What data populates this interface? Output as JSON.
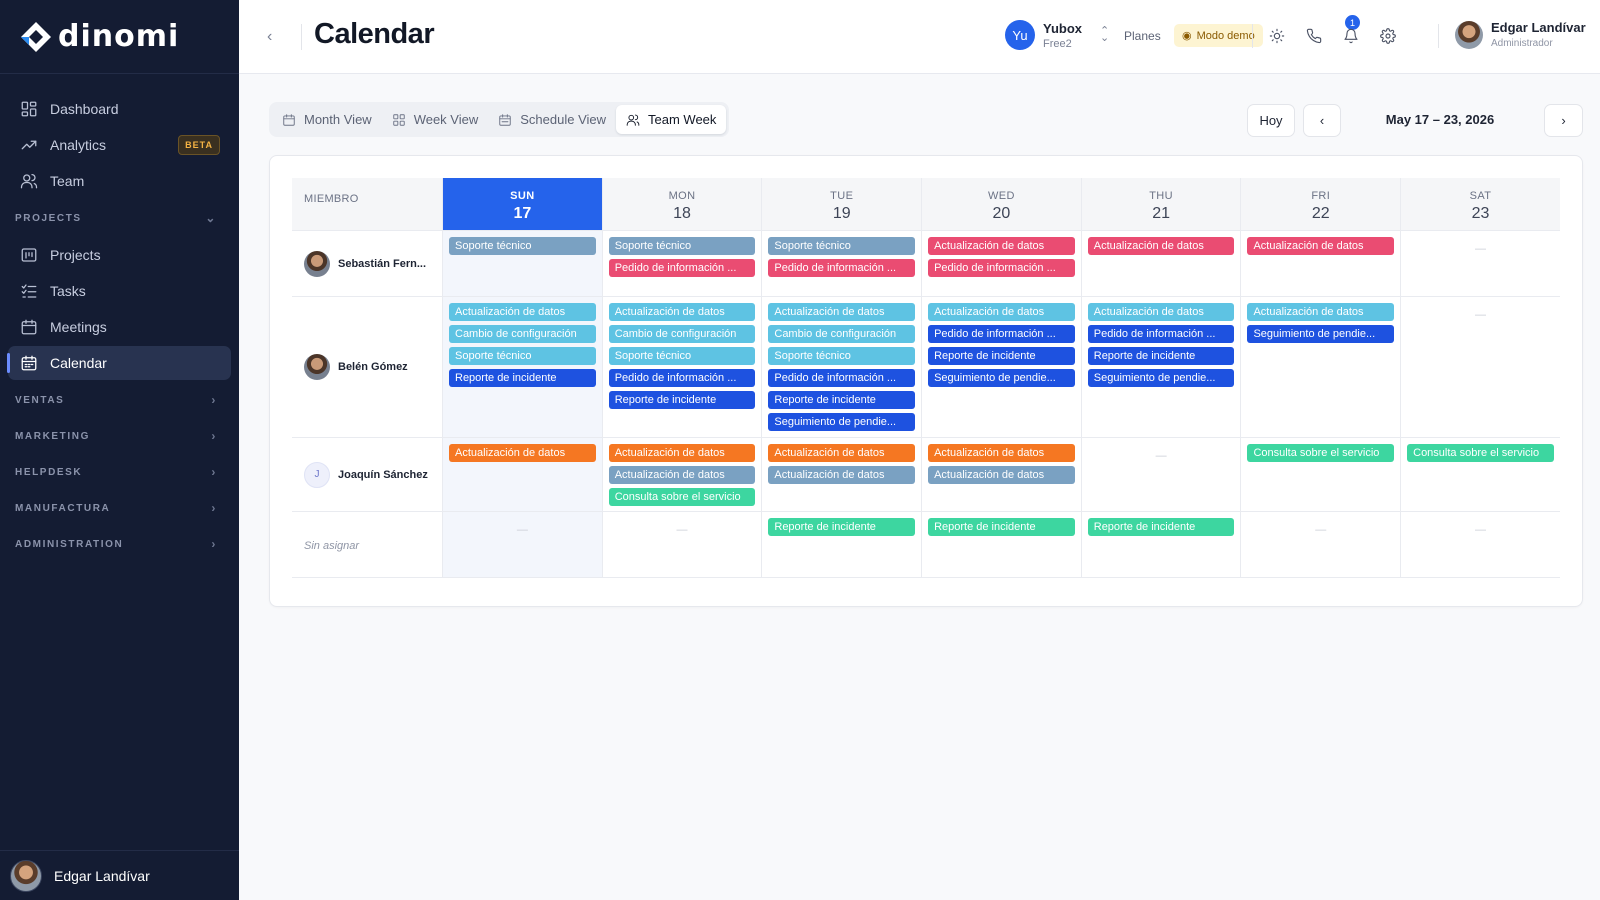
{
  "app": {
    "logo_text": "dinomi",
    "page_title": "Calendar",
    "back_icon": "chevron-left"
  },
  "sidebar": {
    "items": [
      {
        "label": "Dashboard",
        "icon": "dashboard-icon"
      },
      {
        "label": "Analytics",
        "icon": "analytics-icon",
        "badge": "BETA"
      },
      {
        "label": "Team",
        "icon": "team-icon"
      }
    ],
    "projects_section": "PROJECTS",
    "project_items": [
      {
        "label": "Projects",
        "icon": "projects-icon"
      },
      {
        "label": "Tasks",
        "icon": "tasks-icon"
      },
      {
        "label": "Meetings",
        "icon": "meetings-icon"
      },
      {
        "label": "Calendar",
        "icon": "calendar-icon",
        "active": true
      }
    ],
    "sections": [
      "VENTAS",
      "MARKETING",
      "HELPDESK",
      "MANUFACTURA",
      "ADMINISTRATION"
    ],
    "footer_user": "Edgar Landívar"
  },
  "header": {
    "org_initials": "Yu",
    "org_name": "Yubox",
    "org_plan": "Free2",
    "planes_label": "Planes",
    "demo_label": "Modo demo",
    "notification_count": "1",
    "user_name": "Edgar Landívar",
    "user_role": "Administrador",
    "icons": [
      "sun-icon",
      "phone-icon",
      "bell-icon",
      "gear-icon"
    ]
  },
  "toolbar": {
    "views": [
      {
        "label": "Month View",
        "icon": "calendar-icon"
      },
      {
        "label": "Week View",
        "icon": "grid-icon"
      },
      {
        "label": "Schedule View",
        "icon": "calendar-icon"
      },
      {
        "label": "Team Week",
        "icon": "users-icon",
        "active": true
      }
    ],
    "today_label": "Hoy",
    "date_range": "May 17 – 23, 2026"
  },
  "calendar": {
    "member_header": "MIEMBRO",
    "days": [
      {
        "name": "SUN",
        "num": "17",
        "today": true
      },
      {
        "name": "MON",
        "num": "18"
      },
      {
        "name": "TUE",
        "num": "19"
      },
      {
        "name": "WED",
        "num": "20"
      },
      {
        "name": "THU",
        "num": "21"
      },
      {
        "name": "FRI",
        "num": "22"
      },
      {
        "name": "SAT",
        "num": "23"
      }
    ],
    "empty_marker": "—",
    "event_colors": {
      "gray": "#7aa1c2",
      "red": "#ea4c72",
      "cyan": "#5ec3e3",
      "blue": "#1e52e0",
      "orange": "#f57722",
      "green": "#3dd6a0"
    },
    "rows": [
      {
        "member": "Sebastián Fern...",
        "avatar": "photo",
        "days": [
          [
            {
              "t": "Soporte técnico",
              "c": "gray"
            }
          ],
          [
            {
              "t": "Soporte técnico",
              "c": "gray"
            },
            {
              "t": "Pedido de información ...",
              "c": "red"
            }
          ],
          [
            {
              "t": "Soporte técnico",
              "c": "gray"
            },
            {
              "t": "Pedido de información ...",
              "c": "red"
            }
          ],
          [
            {
              "t": "Actualización de datos",
              "c": "red"
            },
            {
              "t": "Pedido de información ...",
              "c": "red"
            }
          ],
          [
            {
              "t": "Actualización de datos",
              "c": "red"
            }
          ],
          [
            {
              "t": "Actualización de datos",
              "c": "red"
            }
          ],
          []
        ]
      },
      {
        "member": "Belén Gómez",
        "avatar": "photo",
        "days": [
          [
            {
              "t": "Actualización de datos",
              "c": "cyan"
            },
            {
              "t": "Cambio de configuración",
              "c": "cyan"
            },
            {
              "t": "Soporte técnico",
              "c": "cyan"
            },
            {
              "t": "Reporte de incidente",
              "c": "blue"
            }
          ],
          [
            {
              "t": "Actualización de datos",
              "c": "cyan"
            },
            {
              "t": "Cambio de configuración",
              "c": "cyan"
            },
            {
              "t": "Soporte técnico",
              "c": "cyan"
            },
            {
              "t": "Pedido de información ...",
              "c": "blue"
            },
            {
              "t": "Reporte de incidente",
              "c": "blue"
            }
          ],
          [
            {
              "t": "Actualización de datos",
              "c": "cyan"
            },
            {
              "t": "Cambio de configuración",
              "c": "cyan"
            },
            {
              "t": "Soporte técnico",
              "c": "cyan"
            },
            {
              "t": "Pedido de información ...",
              "c": "blue"
            },
            {
              "t": "Reporte de incidente",
              "c": "blue"
            },
            {
              "t": "Seguimiento de pendie...",
              "c": "blue"
            }
          ],
          [
            {
              "t": "Actualización de datos",
              "c": "cyan"
            },
            {
              "t": "Pedido de información ...",
              "c": "blue"
            },
            {
              "t": "Reporte de incidente",
              "c": "blue"
            },
            {
              "t": "Seguimiento de pendie...",
              "c": "blue"
            }
          ],
          [
            {
              "t": "Actualización de datos",
              "c": "cyan"
            },
            {
              "t": "Pedido de información ...",
              "c": "blue"
            },
            {
              "t": "Reporte de incidente",
              "c": "blue"
            },
            {
              "t": "Seguimiento de pendie...",
              "c": "blue"
            }
          ],
          [
            {
              "t": "Actualización de datos",
              "c": "cyan"
            },
            {
              "t": "Seguimiento de pendie...",
              "c": "blue"
            }
          ],
          []
        ]
      },
      {
        "member": "Joaquín Sánchez",
        "avatar": "J",
        "days": [
          [
            {
              "t": "Actualización de datos",
              "c": "orange"
            }
          ],
          [
            {
              "t": "Actualización de datos",
              "c": "orange"
            },
            {
              "t": "Actualización de datos",
              "c": "gray"
            },
            {
              "t": "Consulta sobre el servicio",
              "c": "green"
            }
          ],
          [
            {
              "t": "Actualización de datos",
              "c": "orange"
            },
            {
              "t": "Actualización de datos",
              "c": "gray"
            }
          ],
          [
            {
              "t": "Actualización de datos",
              "c": "orange"
            },
            {
              "t": "Actualización de datos",
              "c": "gray"
            }
          ],
          [],
          [
            {
              "t": "Consulta sobre el servicio",
              "c": "green"
            }
          ],
          [
            {
              "t": "Consulta sobre el servicio",
              "c": "green"
            }
          ]
        ]
      },
      {
        "member": "Sin asignar",
        "avatar": "none",
        "days": [
          [],
          [],
          [
            {
              "t": "Reporte de incidente",
              "c": "green"
            }
          ],
          [
            {
              "t": "Reporte de incidente",
              "c": "green"
            }
          ],
          [
            {
              "t": "Reporte de incidente",
              "c": "green"
            }
          ],
          [],
          []
        ]
      }
    ]
  }
}
